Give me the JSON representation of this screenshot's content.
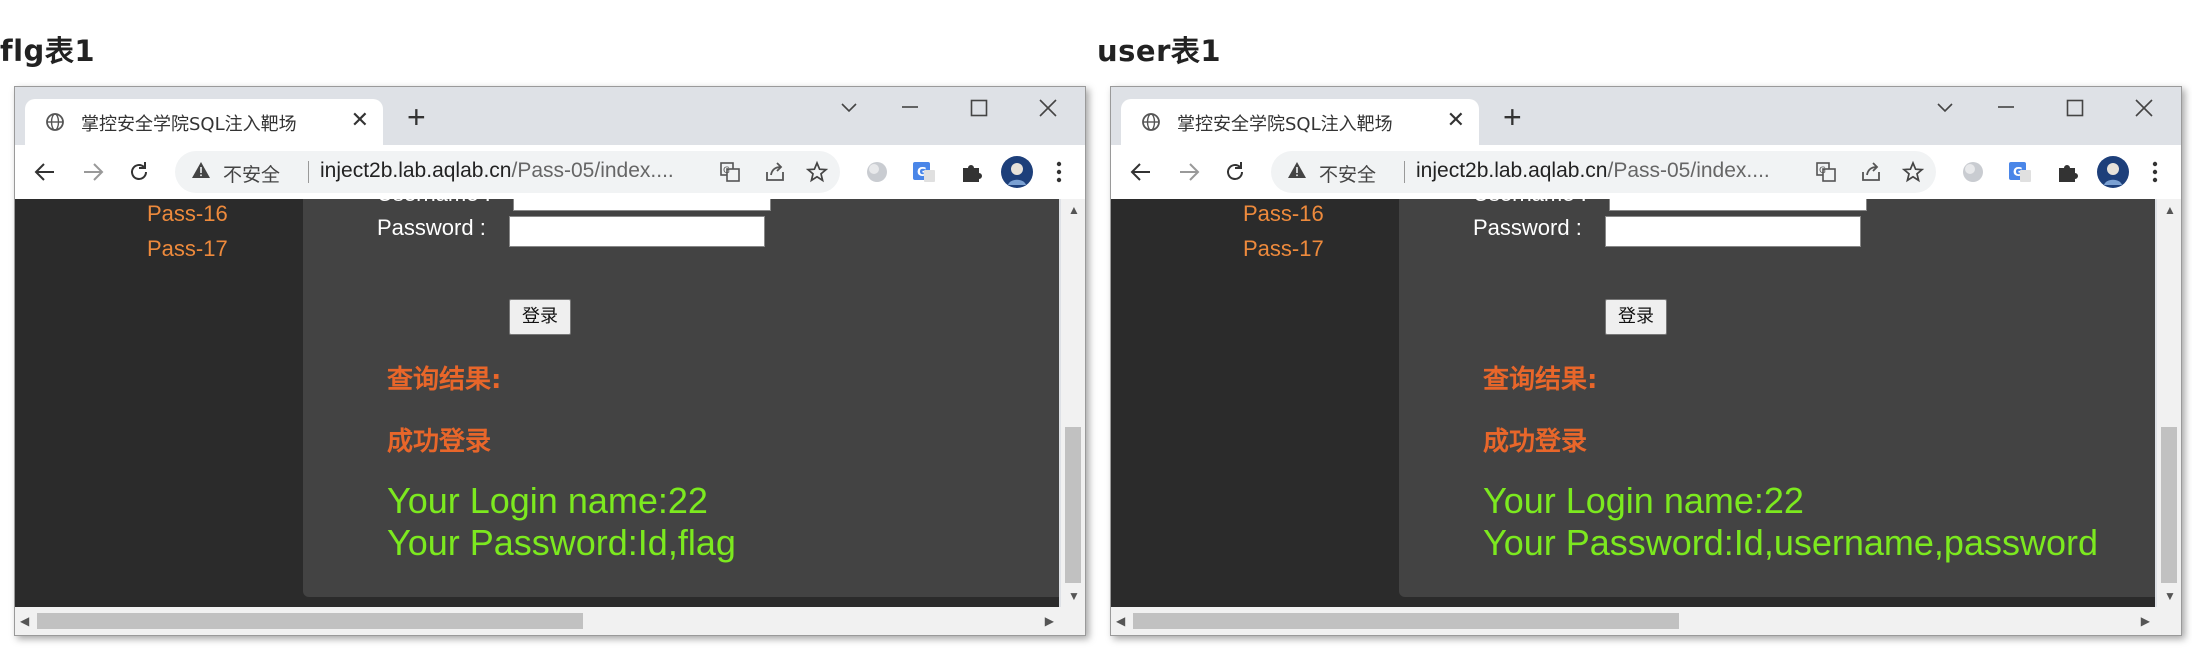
{
  "panels": [
    {
      "caption": "flg表1",
      "browser": {
        "tab_title": "掌控安全学院SQL注入靶场",
        "close_label": "✕",
        "new_tab_label": "+",
        "security_label": "不安全",
        "url_host": "inject2b.lab.aqlab.cn",
        "url_path": "/Pass-05/index...."
      },
      "sidebar": {
        "items": [
          "Pass-16",
          "Pass-17"
        ]
      },
      "form": {
        "username_label": "Username :",
        "password_label": "Password :",
        "login_button": "登录"
      },
      "result": {
        "query_label": "查询结果:",
        "success_label": "成功登录",
        "login_name": "Your Login name:22",
        "password_line": "Your Password:Id,flag"
      }
    },
    {
      "caption": "user表1",
      "browser": {
        "tab_title": "掌控安全学院SQL注入靶场",
        "close_label": "✕",
        "new_tab_label": "+",
        "security_label": "不安全",
        "url_host": "inject2b.lab.aqlab.cn",
        "url_path": "/Pass-05/index...."
      },
      "sidebar": {
        "items": [
          "Pass-16",
          "Pass-17"
        ]
      },
      "form": {
        "username_label": "Username :",
        "password_label": "Password :",
        "login_button": "登录"
      },
      "result": {
        "query_label": "查询结果:",
        "success_label": "成功登录",
        "login_name": "Your Login name:22",
        "password_line": "Your Password:Id,username,password"
      }
    }
  ],
  "colors": {
    "sidebar_bg": "#2b2b2b",
    "main_bg": "#434343",
    "link_orange": "#ee8a3c",
    "result_orange": "#e8662a",
    "result_green": "#7ce91f"
  },
  "icons": {
    "tab": "globe-icon",
    "nav": [
      "back-arrow-icon",
      "forward-arrow-icon",
      "reload-icon"
    ],
    "omnibox": [
      "warning-icon",
      "translate-icon",
      "share-icon",
      "star-icon"
    ],
    "toolbar": [
      "extension-globe-icon",
      "google-translate-extension-icon",
      "puzzle-icon",
      "avatar",
      "kebab-menu-icon"
    ]
  }
}
